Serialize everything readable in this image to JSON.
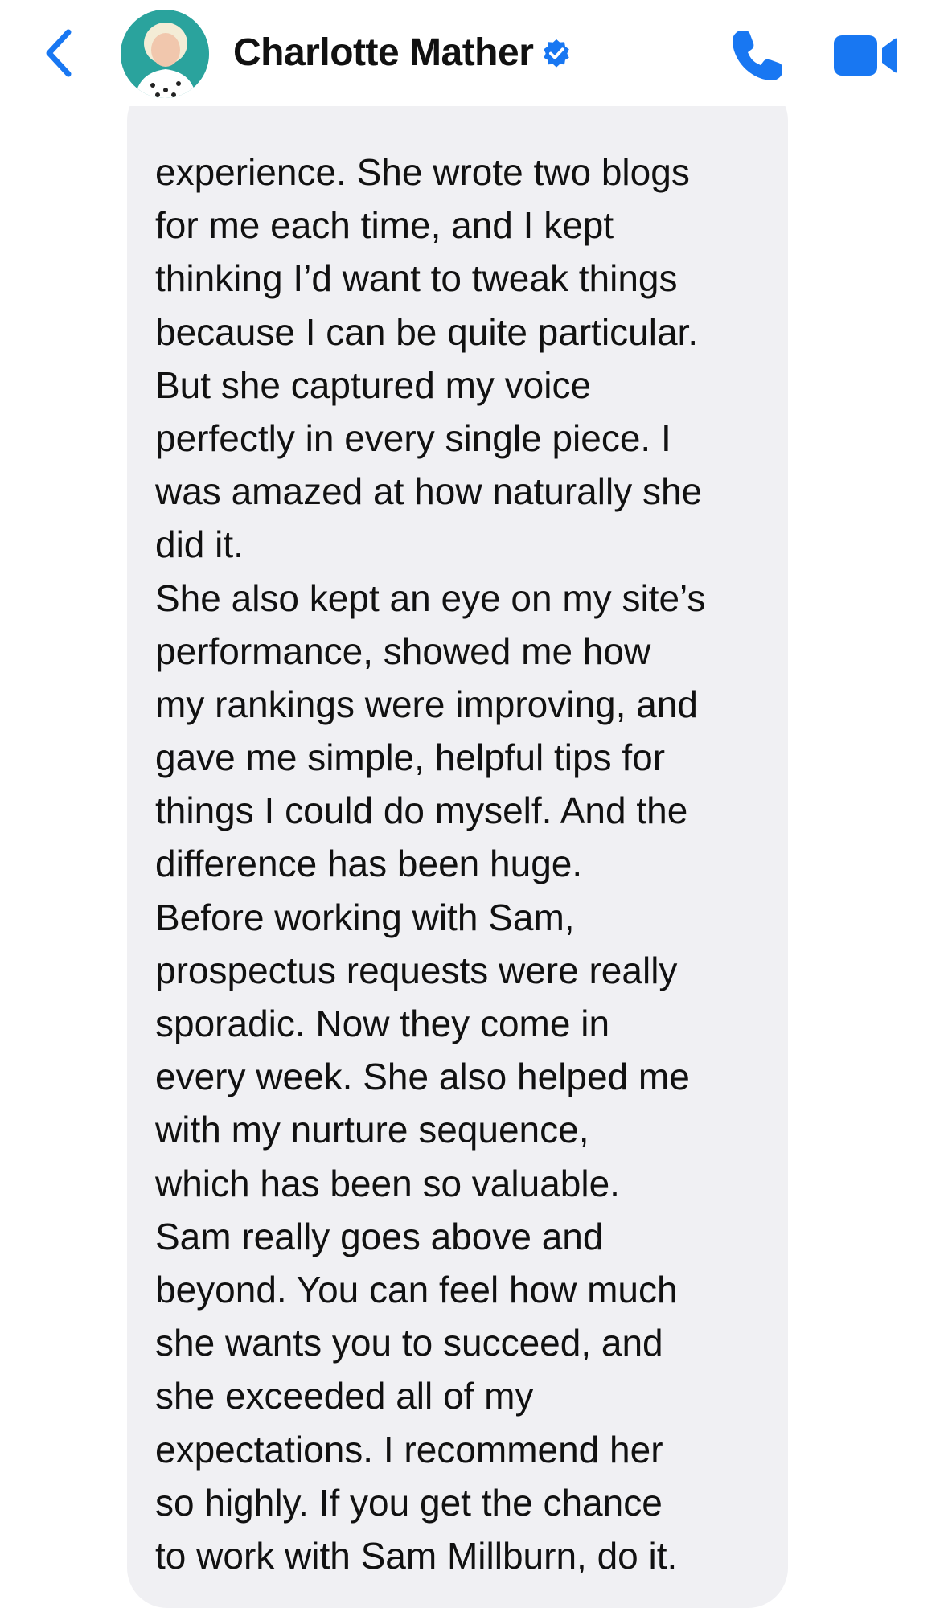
{
  "header": {
    "back_icon": "chevron-left-icon",
    "contact_name": "Charlotte Mather",
    "verified_icon": "verified-badge-icon",
    "call_icon": "phone-icon",
    "video_icon": "video-camera-icon",
    "accent_color": "#1877f2"
  },
  "message": {
    "bubble_color": "#f0f0f3",
    "lines": [
      "experience. She wrote two blogs",
      "for me each time, and I kept",
      "thinking I’d want to tweak things",
      "because I can be quite particular.",
      "But she captured my voice",
      "perfectly in every single piece. I",
      "was amazed at how naturally she",
      "did it.",
      "She also kept an eye on my site’s",
      "performance, showed me how",
      "my rankings were improving, and",
      "gave me simple, helpful tips for",
      "things I could do myself. And the",
      "difference has been huge.",
      "Before working with Sam,",
      "prospectus requests were really",
      "sporadic. Now they come in",
      "every week. She also helped me",
      "with my nurture sequence,",
      "which has been so valuable.",
      "Sam really goes above and",
      "beyond. You can feel how much",
      "she wants you to succeed, and",
      "she exceeded all of my",
      "expectations. I recommend her",
      "so highly. If you get the chance",
      "to work with Sam Millburn, do it."
    ]
  }
}
